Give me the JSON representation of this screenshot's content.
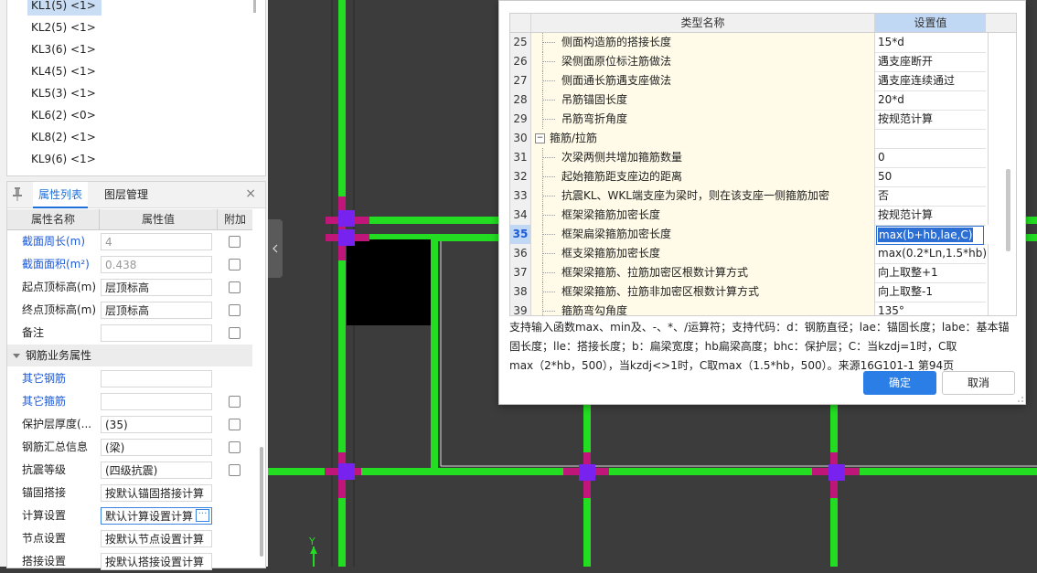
{
  "tree": {
    "items": [
      "KL1(5) <1>",
      "KL2(5) <1>",
      "KL3(6) <1>",
      "KL4(5) <1>",
      "KL5(3) <1>",
      "KL6(2) <0>",
      "KL8(2) <1>",
      "KL9(6) <1>"
    ]
  },
  "props": {
    "tabs": [
      "属性列表",
      "图层管理"
    ],
    "close_glyph": "×",
    "headers": [
      "属性名称",
      "属性值",
      "附加"
    ],
    "rows": [
      {
        "name": "截面周长(m)",
        "value": "4"
      },
      {
        "name": "截面面积(m²)",
        "value": "0.438"
      },
      {
        "name": "起点顶标高(m)",
        "value": "层顶标高"
      },
      {
        "name": "终点顶标高(m)",
        "value": "层顶标高"
      },
      {
        "name": "备注",
        "value": ""
      },
      {
        "name": "钢筋业务属性",
        "value": ""
      },
      {
        "name": "其它钢筋",
        "value": ""
      },
      {
        "name": "其它箍筋",
        "value": ""
      },
      {
        "name": "保护层厚度(...",
        "value": "(35)"
      },
      {
        "name": "钢筋汇总信息",
        "value": "(梁)"
      },
      {
        "name": "抗震等级",
        "value": "(四级抗震)"
      },
      {
        "name": "锚固搭接",
        "value": "按默认锚固搭接计算"
      },
      {
        "name": "计算设置",
        "value": "默认计算设置计算"
      },
      {
        "name": "节点设置",
        "value": "按默认节点设置计算"
      },
      {
        "name": "搭接设置",
        "value": "按默认搭接设置计算"
      }
    ],
    "ellipsis": "···"
  },
  "canvas": {
    "axis_label": "Y",
    "colors": {
      "background": "#3c3c3c",
      "beam": "#22dd22",
      "node": "#7722ee",
      "joint": "#c0167a",
      "column": "#000000"
    }
  },
  "dialog": {
    "headers": {
      "name": "类型名称",
      "value": "设置值"
    },
    "rows": [
      {
        "num": "25",
        "name": "侧面构造筋的搭接长度",
        "value": "15*d"
      },
      {
        "num": "26",
        "name": "梁侧面原位标注筋做法",
        "value": "遇支座断开"
      },
      {
        "num": "27",
        "name": "侧面通长筋遇支座做法",
        "value": "遇支座连续通过"
      },
      {
        "num": "28",
        "name": "吊筋锚固长度",
        "value": "20*d"
      },
      {
        "num": "29",
        "name": "吊筋弯折角度",
        "value": "按规范计算"
      },
      {
        "num": "30",
        "name": "箍筋/拉筋",
        "value": ""
      },
      {
        "num": "31",
        "name": "次梁两侧共增加箍筋数量",
        "value": "0"
      },
      {
        "num": "32",
        "name": "起始箍筋距支座边的距离",
        "value": "50"
      },
      {
        "num": "33",
        "name": "抗震KL、WKL端支座为梁时，则在该支座一侧箍筋加密",
        "value": "否"
      },
      {
        "num": "34",
        "name": "框架梁箍筋加密长度",
        "value": "按规范计算"
      },
      {
        "num": "35",
        "name": "框架扁梁箍筋加密长度",
        "value": "max(b+hb,lae,C)"
      },
      {
        "num": "36",
        "name": "框支梁箍筋加密长度",
        "value": "max(0.2*Ln,1.5*hb)"
      },
      {
        "num": "37",
        "name": "框架梁箍筋、拉筋加密区根数计算方式",
        "value": "向上取整+1"
      },
      {
        "num": "38",
        "name": "框架梁箍筋、拉筋非加密区根数计算方式",
        "value": "向上取整-1"
      },
      {
        "num": "39",
        "name": "箍筋弯勾角度",
        "value": "135°"
      }
    ],
    "collapse_glyph": "−",
    "help_lines": [
      "支持输入函数max、min及、-、*、/运算符；支持代码：d：钢筋直径；lae：锚固长度；labe：基本锚",
      "固长度；lle：搭接长度；b：扁梁宽度；hb扁梁高度；bhc：保护层；C：当kzdj=1时，C取",
      "max（2*hb，500），当kzdj<>1时，C取max（1.5*hb，500）。来源16G101-1 第94页"
    ],
    "ok_label": "确定",
    "cancel_label": "取消"
  }
}
